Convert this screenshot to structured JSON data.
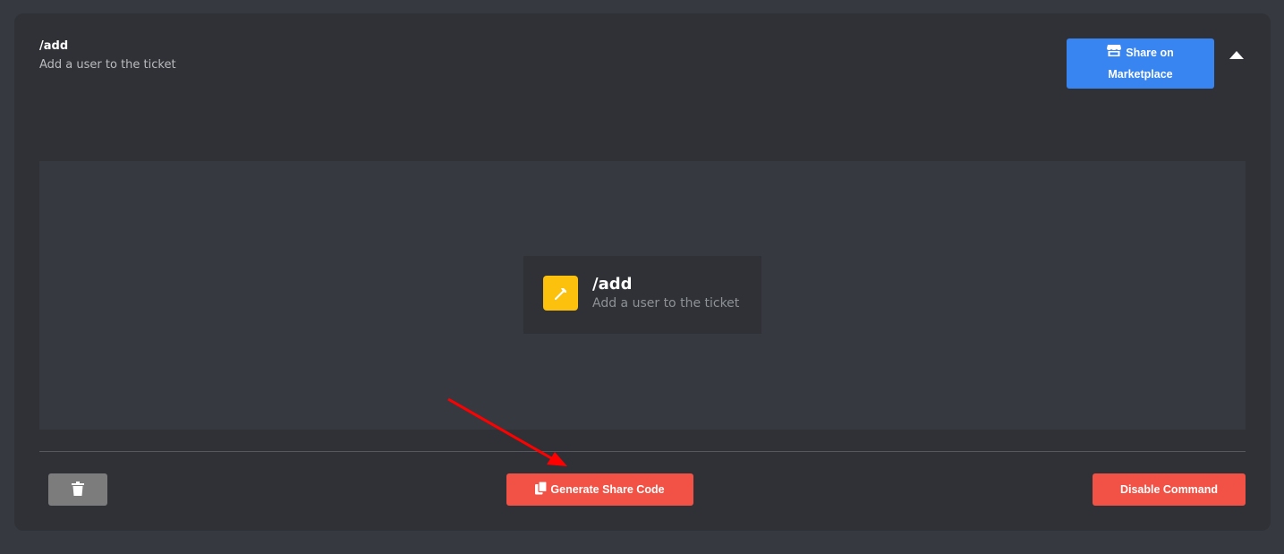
{
  "command": {
    "name": "/add",
    "description": "Add a user to the ticket"
  },
  "header": {
    "share_label_line1": "Share on",
    "share_label_line2": "Marketplace",
    "store_icon": "store-icon",
    "collapse_icon": "caret-up-icon"
  },
  "preview": {
    "icon": "hammer-icon",
    "icon_color": "#fcc10c",
    "name": "/add",
    "description": "Add a user to the ticket"
  },
  "footer": {
    "delete_icon": "trash-icon",
    "generate_label": "Generate Share Code",
    "copy_icon": "copy-icon",
    "disable_label": "Disable Command"
  },
  "colors": {
    "primary": "#3884f0",
    "danger": "#f25245",
    "neutral": "#7c7c7c",
    "annotation_arrow": "#ff0000"
  }
}
